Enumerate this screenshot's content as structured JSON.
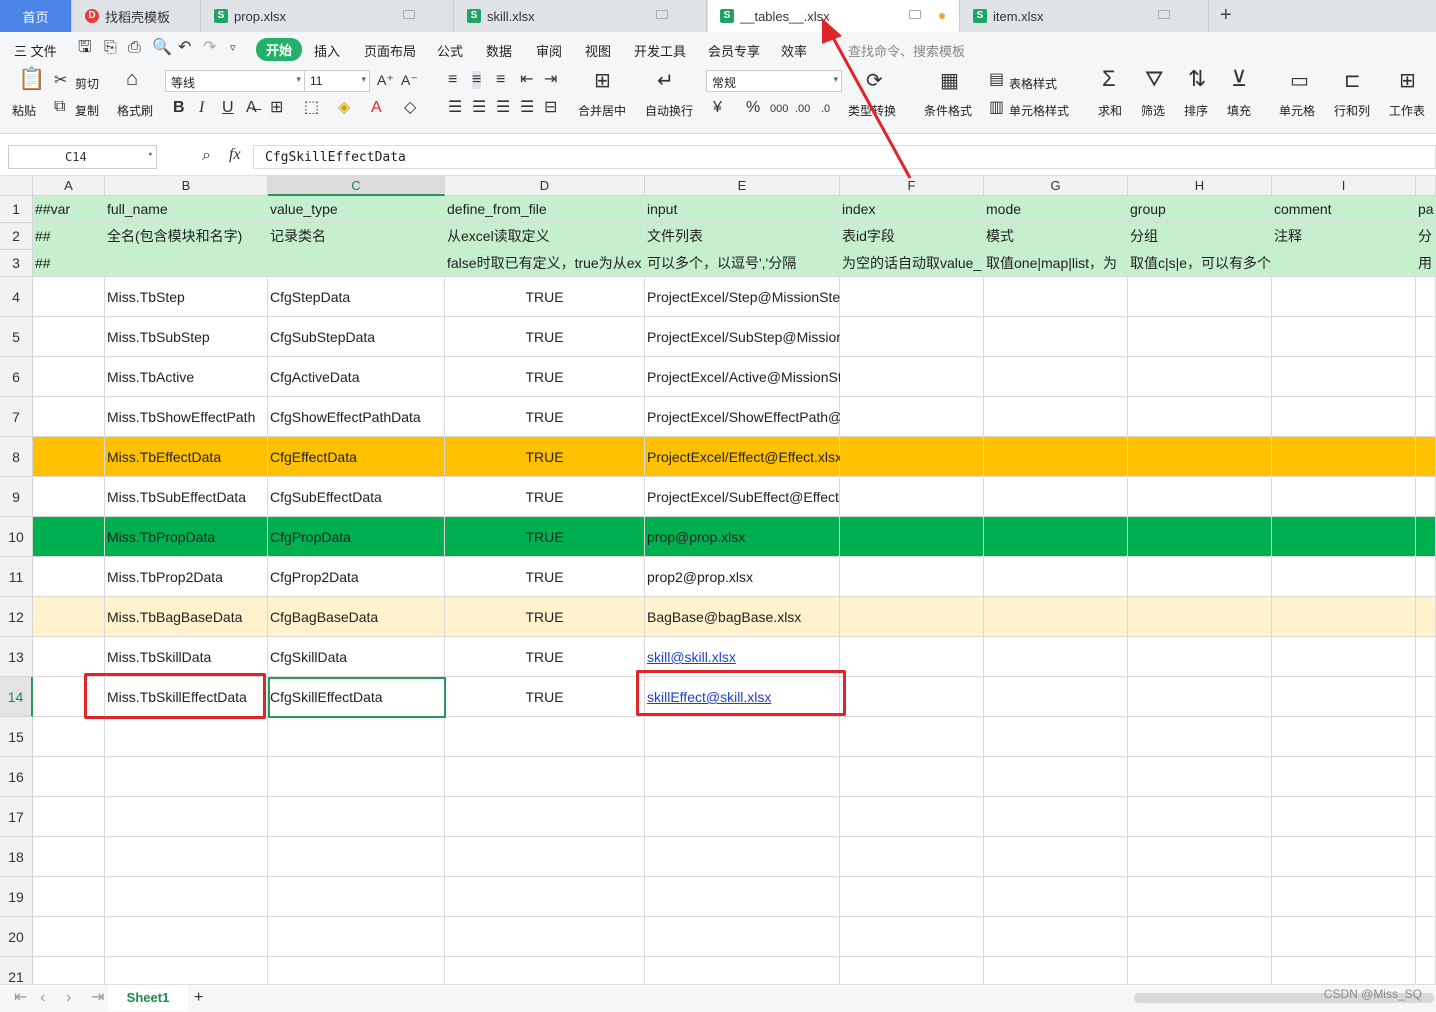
{
  "tabs": [
    {
      "label": "首页",
      "type": "home"
    },
    {
      "label": "找稻壳模板",
      "type": "docer"
    },
    {
      "label": "prop.xlsx",
      "type": "sheet"
    },
    {
      "label": "skill.xlsx",
      "type": "sheet"
    },
    {
      "label": "__tables__.xlsx",
      "type": "sheet",
      "active": true
    },
    {
      "label": "item.xlsx",
      "type": "sheet"
    }
  ],
  "menu": {
    "file": "三 文件",
    "items": [
      "开始",
      "插入",
      "页面布局",
      "公式",
      "数据",
      "审阅",
      "视图",
      "开发工具",
      "会员专享",
      "效率"
    ],
    "search": "查找命令、搜索模板"
  },
  "ribbon": {
    "paste": "粘贴",
    "cut": "剪切",
    "copy": "复制",
    "format_painter": "格式刷",
    "font": "等线",
    "font_size": "11",
    "bold": "B",
    "italic": "I",
    "underline": "U",
    "merge": "合并居中",
    "wrap": "自动换行",
    "number_format": "常规",
    "currency": "¥",
    "percent": "%",
    "type_convert": "类型转换",
    "cond_format": "条件格式",
    "table_style": "表格样式",
    "cell_style": "单元格样式",
    "sum": "求和",
    "filter": "筛选",
    "sort": "排序",
    "fill": "填充",
    "cells": "单元格",
    "rowcol": "行和列",
    "worksheet": "工作表"
  },
  "formula": {
    "name_box": "C14",
    "fx": "fx",
    "value": "CfgSkillEffectData"
  },
  "columns": [
    "A",
    "B",
    "C",
    "D",
    "E",
    "F",
    "G",
    "H",
    "I"
  ],
  "rows": [
    {
      "n": "1",
      "cells": [
        "##var",
        "full_name",
        "value_type",
        "define_from_file",
        "input",
        "index",
        "mode",
        "group",
        "comment",
        "pa"
      ]
    },
    {
      "n": "2",
      "cells": [
        "##",
        "全名(包含模块和名字)",
        "记录类名",
        "从excel读取定义",
        "文件列表",
        "表id字段",
        "模式",
        "分组",
        "注释",
        "分"
      ]
    },
    {
      "n": "3",
      "cells": [
        "##",
        "",
        "",
        "false时取已有定义，true为从ex",
        "可以多个，以逗号','分隔",
        "为空的话自动取value_",
        "取值one|map|list，为",
        "取值c|s|e，可以有多个，以逗号','分隔。空则",
        "",
        "用"
      ]
    },
    {
      "n": "4",
      "cells": [
        "",
        "Miss.TbStep",
        "CfgStepData",
        "TRUE",
        "ProjectExcel/Step@MissionStep.xlsx",
        "",
        "",
        "",
        "",
        ""
      ]
    },
    {
      "n": "5",
      "cells": [
        "",
        "Miss.TbSubStep",
        "CfgSubStepData",
        "TRUE",
        "ProjectExcel/SubStep@MissionStep.xlsx",
        "",
        "",
        "",
        "",
        ""
      ]
    },
    {
      "n": "6",
      "cells": [
        "",
        "Miss.TbActive",
        "CfgActiveData",
        "TRUE",
        "ProjectExcel/Active@MissionStep.xlsx",
        "",
        "",
        "",
        "",
        ""
      ]
    },
    {
      "n": "7",
      "cells": [
        "",
        "Miss.TbShowEffectPath",
        "CfgShowEffectPathData",
        "TRUE",
        "ProjectExcel/ShowEffectPath@MissionStep.xlsx",
        "",
        "",
        "",
        "",
        ""
      ]
    },
    {
      "n": "8",
      "cells": [
        "",
        "Miss.TbEffectData",
        "CfgEffectData",
        "TRUE",
        "ProjectExcel/Effect@Effect.xlsx",
        "",
        "",
        "",
        "",
        ""
      ]
    },
    {
      "n": "9",
      "cells": [
        "",
        "Miss.TbSubEffectData",
        "CfgSubEffectData",
        "TRUE",
        "ProjectExcel/SubEffect@Effect.xlsx",
        "",
        "",
        "",
        "",
        ""
      ]
    },
    {
      "n": "10",
      "cells": [
        "",
        "Miss.TbPropData",
        "CfgPropData",
        "TRUE",
        "prop@prop.xlsx",
        "",
        "",
        "",
        "",
        ""
      ]
    },
    {
      "n": "11",
      "cells": [
        "",
        "Miss.TbProp2Data",
        "CfgProp2Data",
        "TRUE",
        "prop2@prop.xlsx",
        "",
        "",
        "",
        "",
        ""
      ]
    },
    {
      "n": "12",
      "cells": [
        "",
        "Miss.TbBagBaseData",
        "CfgBagBaseData",
        "TRUE",
        "BagBase@bagBase.xlsx",
        "",
        "",
        "",
        "",
        ""
      ]
    },
    {
      "n": "13",
      "cells": [
        "",
        "Miss.TbSkillData",
        "CfgSkillData",
        "TRUE",
        "skill@skill.xlsx",
        "",
        "",
        "",
        "",
        ""
      ]
    },
    {
      "n": "14",
      "cells": [
        "",
        "Miss.TbSkillEffectData",
        "CfgSkillEffectData",
        "TRUE",
        "skillEffect@skill.xlsx",
        "",
        "",
        "",
        "",
        ""
      ]
    },
    {
      "n": "15",
      "cells": []
    },
    {
      "n": "16",
      "cells": []
    },
    {
      "n": "17",
      "cells": []
    },
    {
      "n": "18",
      "cells": []
    },
    {
      "n": "19",
      "cells": []
    },
    {
      "n": "20",
      "cells": []
    },
    {
      "n": "21",
      "cells": []
    }
  ],
  "colors": {
    "header_green": "#c6efce",
    "orange": "#ffc000",
    "green": "#00b050",
    "light_yellow": "#fff2cc",
    "highlight": "#e0242a"
  },
  "sheet_tab": "Sheet1",
  "watermark": "CSDN @Miss_SQ"
}
